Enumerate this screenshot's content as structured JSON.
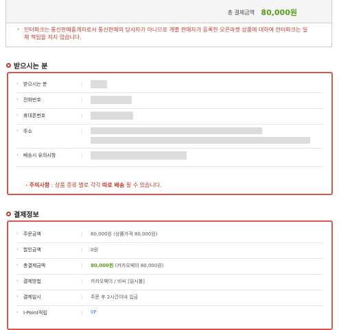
{
  "total": {
    "label": "총 결제금액",
    "value": "80,000원"
  },
  "notice": {
    "text": "인터파크는 통신판매중개자로서 통신판매의 당사자가 아니므로 개별 판매자가 등록한 오픈마켓 상품에 대하여 인터파크는 일체 책임을 지지 않습니다."
  },
  "recipient": {
    "title": "받으시는 분",
    "rows": [
      {
        "label": "받으시는 분"
      },
      {
        "label": "전화번호"
      },
      {
        "label": "휴대폰번호"
      },
      {
        "label": "주소"
      },
      {
        "label": "배송시 유의사항"
      }
    ],
    "caution_prefix": "주의사항",
    "caution_text": ": 상품 종류 별로 각각",
    "caution_bold": "따로 배송",
    "caution_suffix": "될 수 있습니다."
  },
  "payment": {
    "title": "결제정보",
    "rows": [
      {
        "label": "주문금액",
        "value": "80,000원 (상품가격 80,000원)"
      },
      {
        "label": "할인금액",
        "value": "0원"
      },
      {
        "label": "총결제금액",
        "value_strong": "80,000원",
        "value_rest": "(카카오페이 80,000원)"
      },
      {
        "label": "결제방법",
        "value": "카카오페이 / 비씨 [일시불]"
      },
      {
        "label": "결제일시",
        "value": "주문 후 2시간이내 입금"
      },
      {
        "label": "I-Point적립",
        "value": "0P"
      }
    ]
  },
  "colors": {
    "accent": "#d9534f",
    "price": "#5a9e1f",
    "point": "#3a7bd5"
  }
}
